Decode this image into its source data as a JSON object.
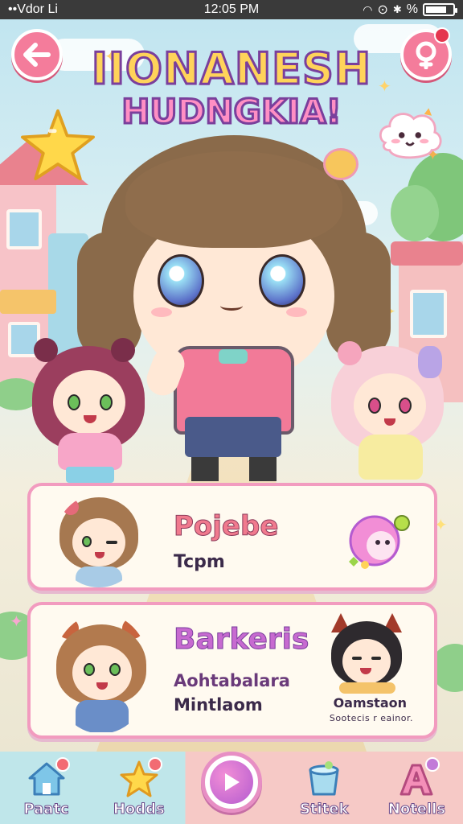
{
  "status_bar": {
    "carrier": "••Vdor Li",
    "time": "12:05 PM",
    "battery_text": "%"
  },
  "header": {
    "title_line1": "IIONANESH",
    "title_line2": "HUDNGKIA!",
    "back_icon": "back-arrow-icon",
    "profile_icon": "profile-icon"
  },
  "cards": [
    {
      "title": "Pojebe",
      "subtitle": "Tcpm",
      "side_icon": "pink-blob-character-icon"
    },
    {
      "title": "Barkeris",
      "subtitle_1": "Aohtabalara",
      "subtitle_2": "Mintlaom",
      "side_name": "Oamstaon",
      "side_caption": "Sootecis r eainor."
    }
  ],
  "bottom_nav": [
    {
      "label": "Paatc",
      "icon": "house-icon"
    },
    {
      "label": "Hodds",
      "icon": "star-icon"
    },
    {
      "label": "",
      "icon": "play-icon"
    },
    {
      "label": "Stitek",
      "icon": "cup-icon"
    },
    {
      "label": "Notells",
      "icon": "letter-a-icon"
    }
  ],
  "colors": {
    "accent_pink": "#f47c9b",
    "card_border": "#f29bbf",
    "title_yellow": "#ffd35a",
    "title_pink": "#ff8fc4",
    "outline_purple": "#7a3f9c"
  }
}
